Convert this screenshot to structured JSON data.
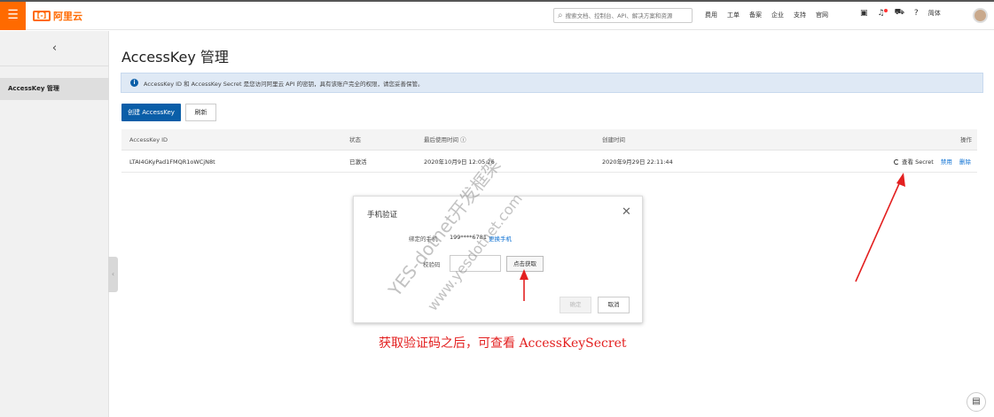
{
  "topbar": {
    "brand": "阿里云",
    "brand_mark": "[-]",
    "search_placeholder": "搜索文档、控制台、API、解决方案和资源",
    "links": [
      "费用",
      "工单",
      "备案",
      "企业",
      "支持",
      "官网"
    ],
    "language": "简体"
  },
  "sidebar": {
    "back_glyph": "‹",
    "items": [
      {
        "label": "AccessKey 管理"
      }
    ]
  },
  "main": {
    "title": "AccessKey 管理",
    "notice": "AccessKey ID 和 AccessKey Secret 是您访问阿里云 API 的密钥，具有该账户完全的权限，请您妥善保管。",
    "create_button": "创建 AccessKey",
    "refresh_button": "刷新",
    "table": {
      "headers": {
        "id": "AccessKey ID",
        "status": "状态",
        "last_used": "最后使用时间",
        "created": "创建时间",
        "ops": "操作"
      },
      "rows": [
        {
          "id": "LTAI4GKyPad1FMQR1oWCjN8t",
          "status": "已激活",
          "last_used": "2020年10月9日 12:05:26",
          "created": "2020年9月29日 22:11:44",
          "op_view": "查看 Secret",
          "op_disable": "禁用",
          "op_delete": "删除"
        }
      ]
    }
  },
  "modal": {
    "title": "手机验证",
    "phone_label": "绑定的手机",
    "phone_value": "199****6781",
    "change_phone": "更换手机",
    "code_label": "校验码",
    "get_code_button": "点击获取",
    "ok_button": "确定",
    "cancel_button": "取消"
  },
  "annotation": {
    "caption": "获取验证码之后，可查看 AccessKeySecret",
    "watermark_1": "YES-dotnet开发框架",
    "watermark_2": "www.yesdotnet.com",
    "arrow_color": "#e32020"
  },
  "icons": {
    "menu": "hamburger-icon",
    "search": "search-icon",
    "terminal": "terminal-icon",
    "bell": "bell-icon",
    "cart": "cart-icon",
    "help": "help-icon",
    "close": "close-icon",
    "chat": "chat-icon",
    "info": "info-icon"
  },
  "colors": {
    "brand": "#ff6a00",
    "primary": "#0a5ea8",
    "link": "#0a6fd3",
    "annotation": "#e32020"
  }
}
